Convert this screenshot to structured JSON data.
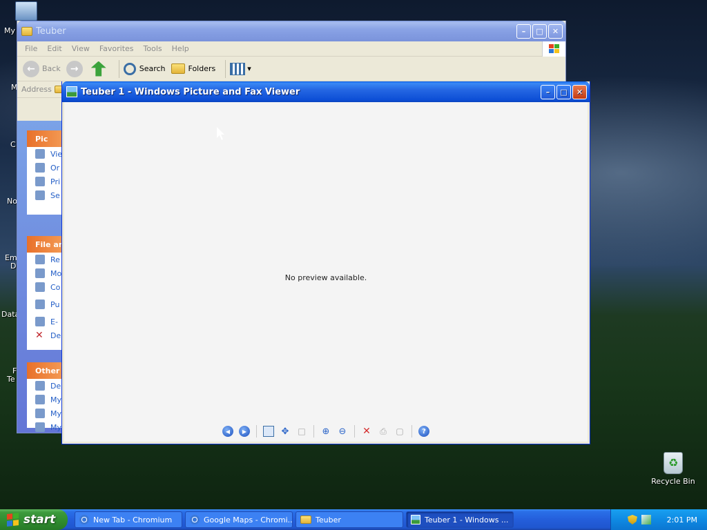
{
  "desktop": {
    "icons": [
      {
        "label": "My"
      },
      {
        "label": "Recycle Bin"
      }
    ],
    "partial_labels": [
      "M",
      "C",
      "No",
      "Em",
      "D",
      "Data",
      "F",
      "Te"
    ]
  },
  "explorer": {
    "title": "Teuber",
    "menu": [
      "File",
      "Edit",
      "View",
      "Favorites",
      "Tools",
      "Help"
    ],
    "toolbar": {
      "back_label": "Back",
      "search_label": "Search",
      "folders_label": "Folders"
    },
    "address_label": "Address",
    "panels": [
      {
        "header": "Pic",
        "items": [
          "Vie",
          "Or",
          "Pri",
          "Se ba"
        ]
      },
      {
        "header": "File an",
        "items": [
          "Re",
          "Mo",
          "Co",
          "Pu We",
          "E-",
          "De"
        ]
      },
      {
        "header": "Other",
        "items": [
          "De",
          "My",
          "My",
          "My"
        ]
      }
    ]
  },
  "viewer": {
    "title": "Teuber 1 - Windows Picture and Fax Viewer",
    "message": "No preview available."
  },
  "taskbar": {
    "start_label": "start",
    "items": [
      {
        "label": "New Tab - Chromium",
        "icon": "chromium-icon",
        "active": false
      },
      {
        "label": "Google Maps - Chromi...",
        "icon": "chromium-icon",
        "active": false
      },
      {
        "label": "Teuber",
        "icon": "folder-icon",
        "active": false
      },
      {
        "label": "Teuber 1 - Windows ...",
        "icon": "picture-viewer-icon",
        "active": true
      }
    ],
    "clock": "2:01 PM"
  },
  "colors": {
    "title_active": "#0d4fd6",
    "start_green": "#2f8b2f",
    "tray_blue": "#0f8ae3",
    "close_red": "#c23a13"
  }
}
